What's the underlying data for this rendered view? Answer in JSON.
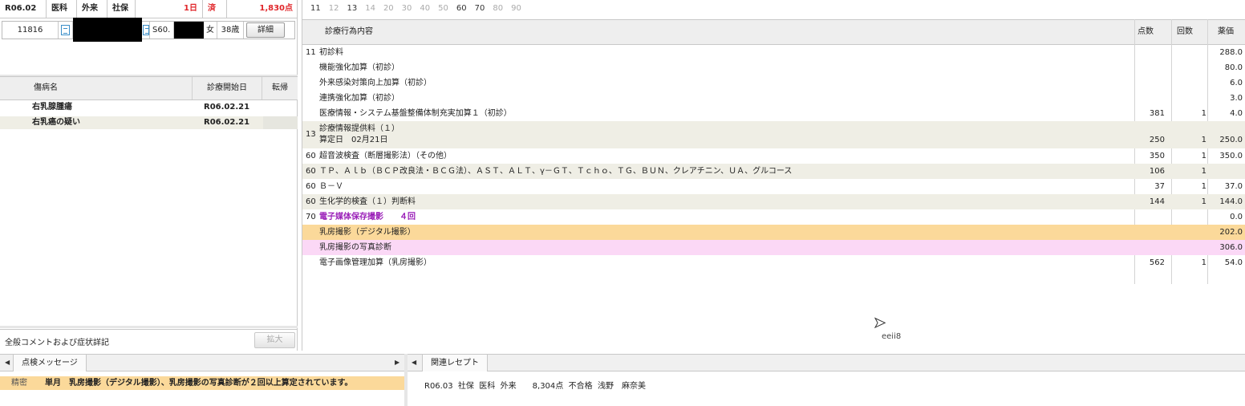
{
  "patient_header": {
    "period": "R06.02",
    "dept1": "医科",
    "dept2": "外来",
    "insurance": "社保",
    "days": "1日",
    "status": "済",
    "total_points": "1,830点",
    "id": "11816",
    "birth_prefix": "S60.",
    "sex": "女",
    "age": "38歳",
    "detail_button": "詳細"
  },
  "diseases": {
    "headers": {
      "name": "傷病名",
      "start": "診療開始日",
      "outcome": "転帰"
    },
    "rows": [
      {
        "name": "右乳腺腫瘍",
        "start": "R06.02.21"
      },
      {
        "name": "右乳癌の疑い",
        "start": "R06.02.21"
      }
    ]
  },
  "comment_bar": {
    "label": "全般コメントおよび症状詳記",
    "expand_button": "拡大"
  },
  "code_tabs": [
    "11",
    "12",
    "13",
    "14",
    "20",
    "30",
    "40",
    "50",
    "60",
    "70",
    "80",
    "90"
  ],
  "active_code_tabs": [
    "11",
    "13",
    "60",
    "70"
  ],
  "procedures": {
    "headers": {
      "content": "診療行為内容",
      "points": "点数",
      "count": "回数",
      "medicine": "薬価"
    },
    "rows": [
      {
        "code": "11",
        "name": "初診料",
        "points": "",
        "count": "",
        "med": "288.0"
      },
      {
        "code": "",
        "name": "機能強化加算（初診）",
        "points": "",
        "count": "",
        "med": "80.0"
      },
      {
        "code": "",
        "name": "外来感染対策向上加算（初診）",
        "points": "",
        "count": "",
        "med": "6.0"
      },
      {
        "code": "",
        "name": "連携強化加算（初診）",
        "points": "",
        "count": "",
        "med": "3.0"
      },
      {
        "code": "",
        "name": "医療情報・システム基盤整備体制充実加算１（初診）",
        "points": "381",
        "count": "1",
        "med": "4.0"
      },
      {
        "code": "13",
        "name": "診療情報提供料（１）",
        "name2": "算定日　02月21日",
        "points": "250",
        "count": "1",
        "med": "250.0"
      },
      {
        "code": "60",
        "name": "超音波検査（断層撮影法）（その他）",
        "points": "350",
        "count": "1",
        "med": "350.0"
      },
      {
        "code": "60",
        "name": "ＴＰ、Ａｌｂ（ＢＣＰ改良法・ＢＣＧ法）、ＡＳＴ、ＡＬＴ、γ－ＧＴ、Ｔｃｈｏ、ＴＧ、ＢＵＮ、クレアチニン、ＵＡ、グルコース",
        "points": "106",
        "count": "1",
        "med": ""
      },
      {
        "code": "60",
        "name": "Ｂ－Ｖ",
        "points": "37",
        "count": "1",
        "med": "37.0"
      },
      {
        "code": "60",
        "name": "生化学的検査（１）判断料",
        "points": "144",
        "count": "1",
        "med": "144.0"
      },
      {
        "code": "70",
        "name": "電子媒体保存撮影　　４回",
        "points": "",
        "count": "",
        "med": "0.0"
      },
      {
        "code": "",
        "name": "乳房撮影（デジタル撮影）",
        "points": "",
        "count": "",
        "med": "202.0"
      },
      {
        "code": "",
        "name": "乳房撮影の写真診断",
        "points": "",
        "count": "",
        "med": "306.0"
      },
      {
        "code": "",
        "name": "電子画像管理加算（乳房撮影）",
        "points": "562",
        "count": "1",
        "med": "54.0"
      }
    ]
  },
  "watermark": "eeii8",
  "check_messages": {
    "tab": "点検メッセージ",
    "items": [
      {
        "level": "精密",
        "text": "単月　乳房撮影（デジタル撮影）、乳房撮影の写真診断が２回以上算定されています。"
      }
    ]
  },
  "related_receipts": {
    "tab": "関連レセプト",
    "items": [
      {
        "text": "R06.03  社保  医科  外来　　8,304点  不合格  浅野　麻奈美"
      }
    ]
  },
  "colors": {
    "orange_row": "#fbd99a",
    "pink_row": "#fbd8f6",
    "purple_text": "#9a1fb8",
    "points_red": "#e0262a"
  }
}
